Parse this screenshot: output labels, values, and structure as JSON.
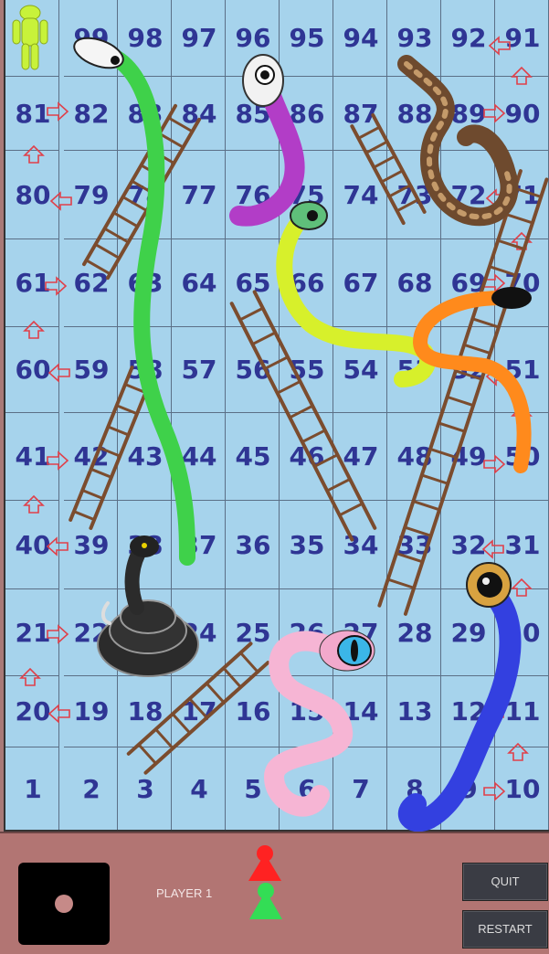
{
  "board": {
    "rows": [
      [
        99,
        98,
        97,
        96,
        95,
        94,
        93,
        92,
        91
      ],
      [
        81,
        82,
        83,
        84,
        85,
        86,
        87,
        88,
        89,
        90
      ],
      [
        80,
        79,
        78,
        77,
        76,
        75,
        74,
        73,
        72,
        71
      ],
      [
        61,
        62,
        63,
        64,
        65,
        66,
        67,
        68,
        69,
        70
      ],
      [
        60,
        59,
        58,
        57,
        56,
        55,
        54,
        53,
        52,
        51
      ],
      [
        41,
        42,
        43,
        44,
        45,
        46,
        47,
        48,
        49,
        50
      ],
      [
        40,
        39,
        38,
        37,
        36,
        35,
        34,
        33,
        32,
        31
      ],
      [
        21,
        22,
        23,
        24,
        25,
        26,
        27,
        28,
        29,
        30
      ],
      [
        20,
        19,
        18,
        17,
        16,
        15,
        14,
        13,
        12,
        11
      ],
      [
        1,
        2,
        3,
        4,
        5,
        6,
        7,
        8,
        9,
        10
      ]
    ],
    "colors": {
      "background": "#a6d3ec",
      "number": "#2f3594",
      "arrow": "#e0404a",
      "ladder": "#8a5a3a"
    },
    "snakes": [
      {
        "name": "green-snake",
        "color": "#3fd14a"
      },
      {
        "name": "purple-snake",
        "color": "#b23dc7"
      },
      {
        "name": "lime-snake",
        "color": "#d7f02b"
      },
      {
        "name": "python-snake",
        "color": "#6e4a2e"
      },
      {
        "name": "orange-snake",
        "color": "#ff8a1c"
      },
      {
        "name": "black-snake",
        "color": "#2b2b2b"
      },
      {
        "name": "pink-snake",
        "color": "#f6b5d4"
      },
      {
        "name": "blue-snake",
        "color": "#3340e0"
      }
    ]
  },
  "panel": {
    "player_label": "PLAYER 1",
    "quit_label": "QUIT",
    "restart_label": "RESTART",
    "die_value": 1,
    "tokens": [
      {
        "name": "red-token",
        "color": "#ff2222"
      },
      {
        "name": "green-token",
        "color": "#33dd55"
      }
    ]
  }
}
